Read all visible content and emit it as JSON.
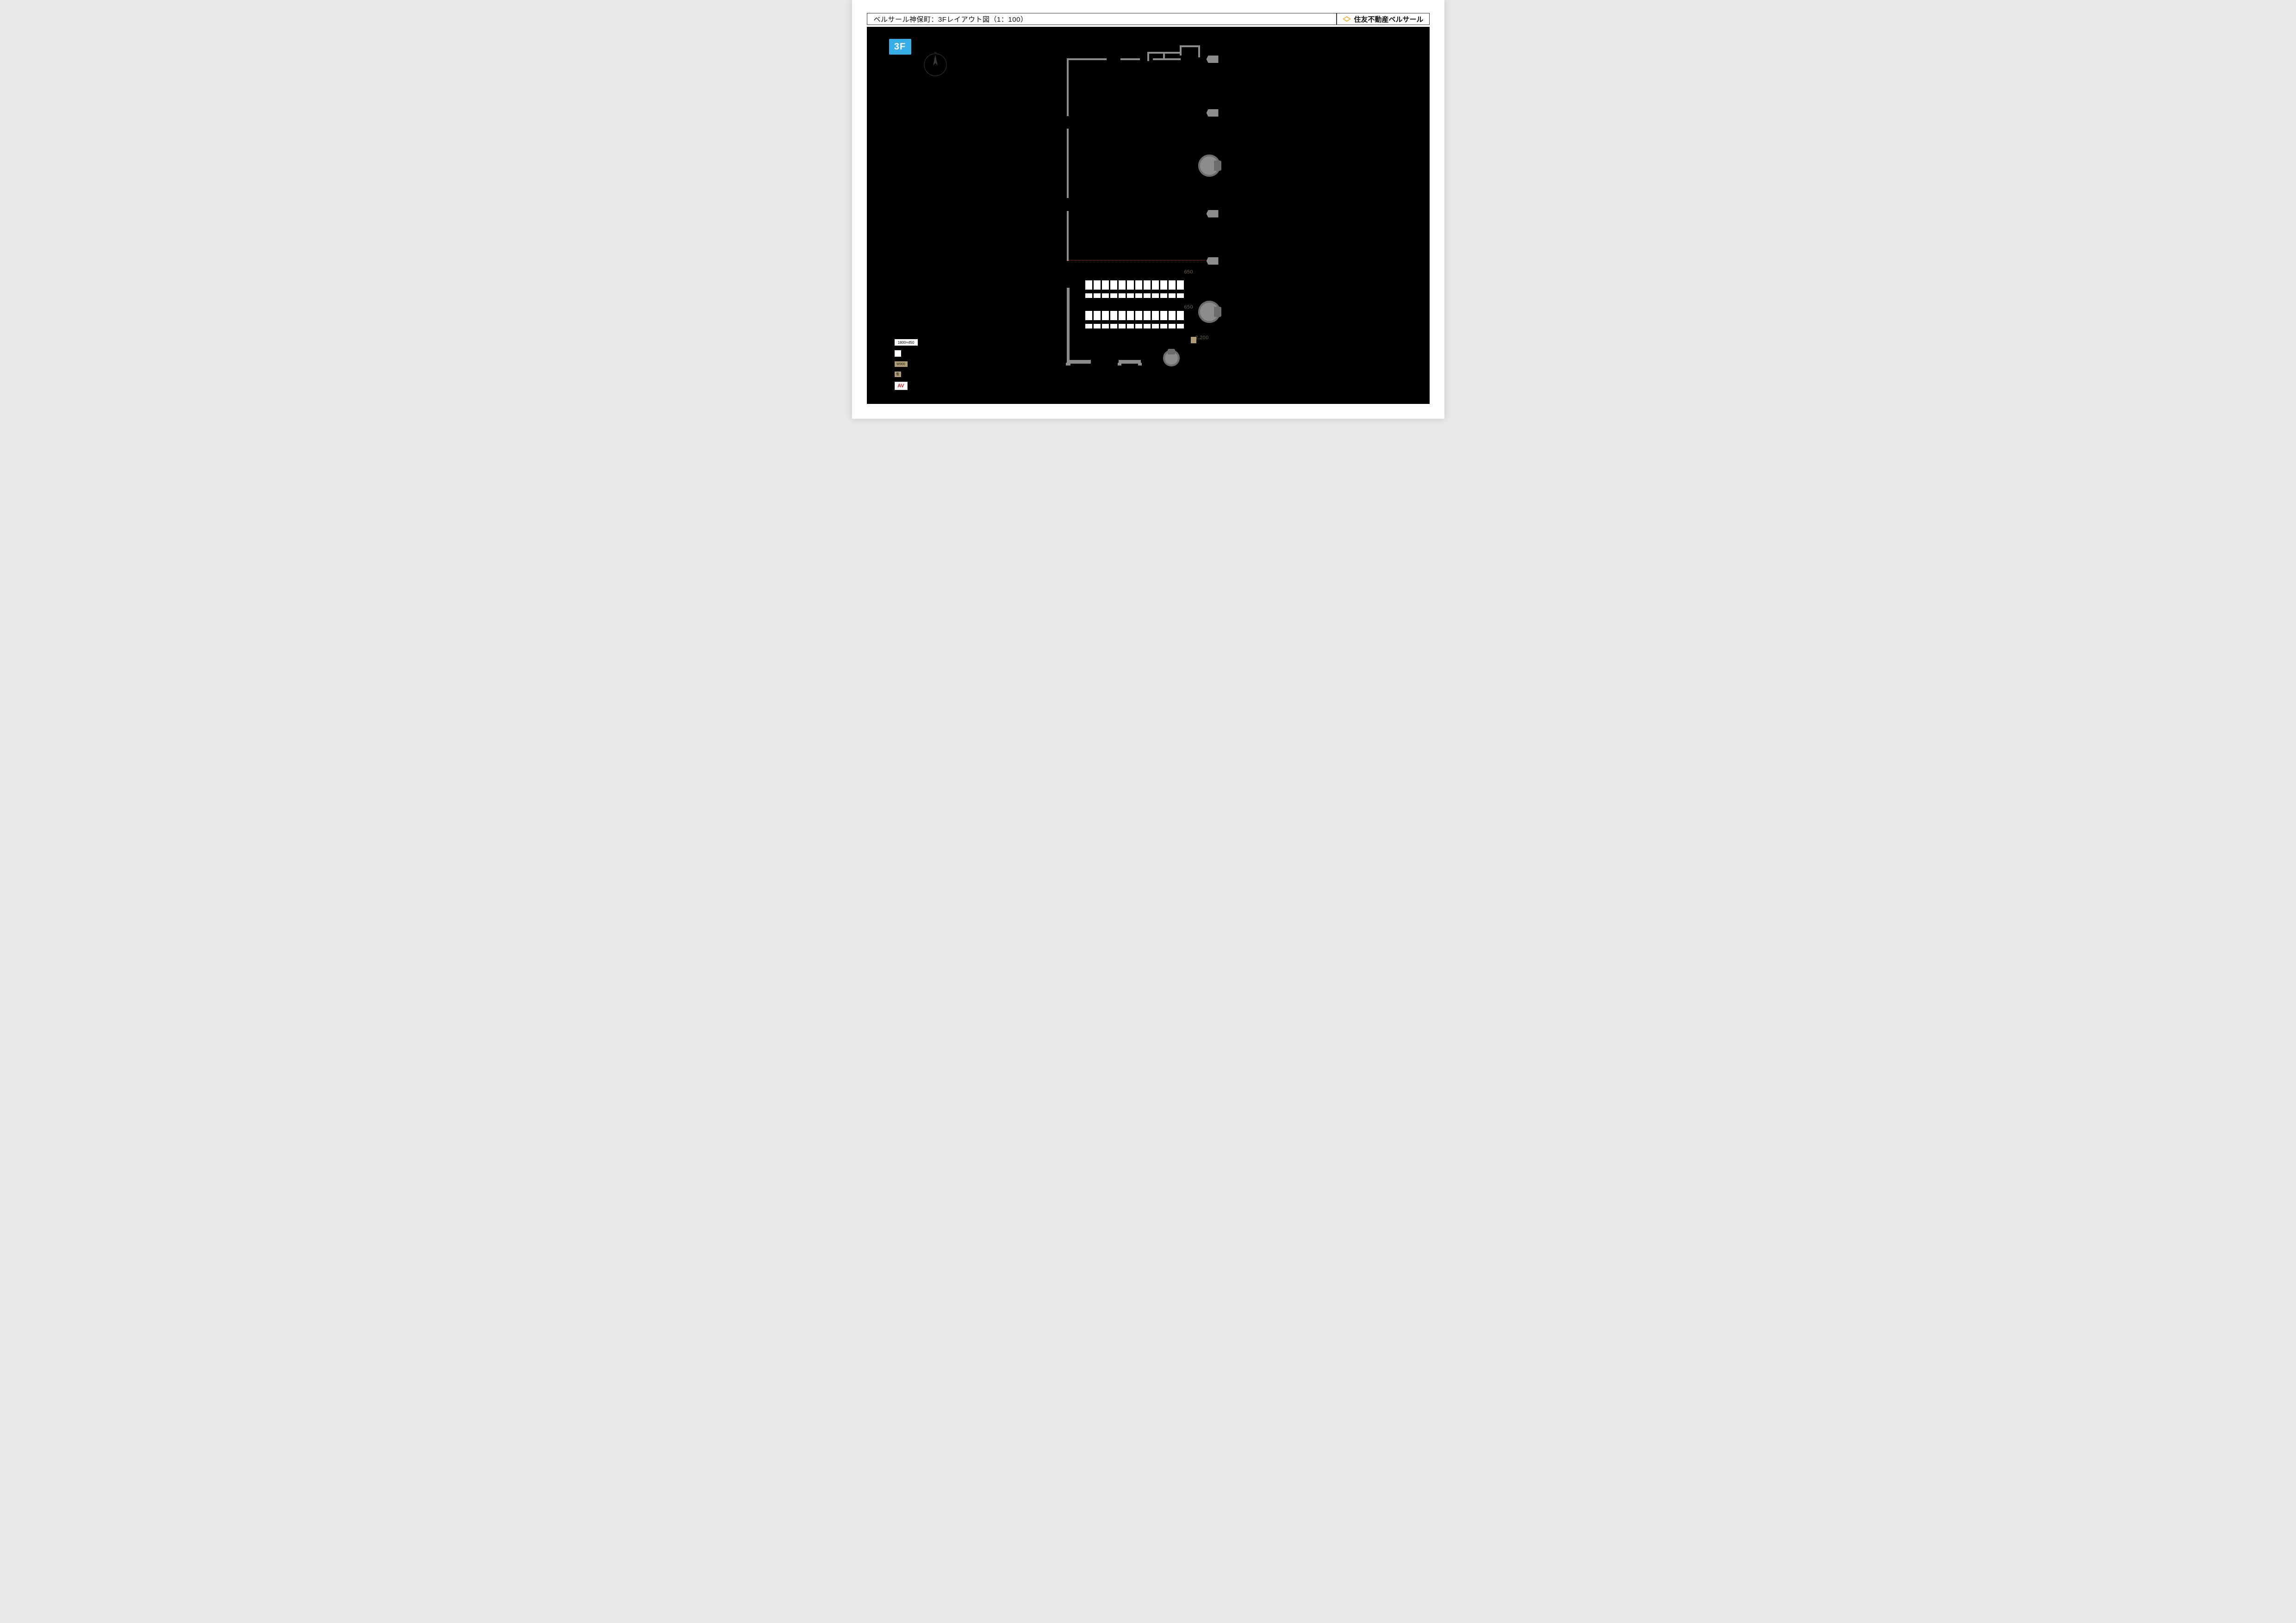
{
  "title": "ベルサール神保町：3Fレイアウト図（1：100）",
  "brand": "住友不動産ベルサール",
  "floor_badge": "3F",
  "dimensions": {
    "row_gap_1": "650",
    "row_gap_2": "650",
    "aisle": "2,200"
  },
  "legend": {
    "table_dim": "1800×450",
    "panel_width": "W900",
    "sign_label": "看",
    "av_label": "AV"
  },
  "seating": {
    "rows": 2,
    "desks_per_row_visible": 12
  },
  "scale": "1:100",
  "colors": {
    "background": "#000000",
    "wall": "#8c8c8c",
    "accent_blue": "#36aee7",
    "accent_orange": "#f3b13a",
    "av_red": "#e02020",
    "beige": "#b09b72"
  }
}
